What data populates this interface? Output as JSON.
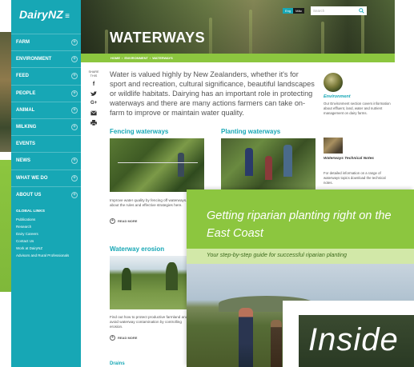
{
  "brand": {
    "logo": "DairyNZ"
  },
  "header": {
    "title": "WATERWAYS",
    "lang": [
      "Eng",
      "Māo"
    ],
    "search_placeholder": "Search"
  },
  "breadcrumb": [
    "HOME",
    "ENVIRONMENT",
    "WATERWAYS"
  ],
  "sidebar": {
    "items": [
      {
        "label": "FARM"
      },
      {
        "label": "ENVIRONMENT"
      },
      {
        "label": "FEED"
      },
      {
        "label": "PEOPLE"
      },
      {
        "label": "ANIMAL"
      },
      {
        "label": "MILKING"
      },
      {
        "label": "EVENTS"
      },
      {
        "label": "NEWS"
      },
      {
        "label": "WHAT WE DO"
      },
      {
        "label": "ABOUT US"
      }
    ],
    "global_heading": "GLOBAL LINKS",
    "global_links": [
      "Publications",
      "Research",
      "Dairy Careers",
      "Contact Us",
      "Work at DairyNZ",
      "Advisors and Rural Professionals"
    ]
  },
  "share": {
    "label_line1": "SHARE",
    "label_line2": "THIS"
  },
  "intro": "Water is valued highly by New Zealanders, whether it's for sport and recreation, cultural significance, beautiful landscapes or wildlife habitats. Dairying has an important role in protecting waterways and there are many actions farmers can take on-farm to improve or maintain water quality.",
  "cards": {
    "fencing": {
      "title": "Fencing waterways",
      "text": "Improve water quality by fencing off waterways. Find out about the rules and effective strategies here.",
      "read_more": "READ MORE"
    },
    "planting": {
      "title": "Planting waterways"
    },
    "erosion": {
      "title": "Waterway erosion",
      "text": "Find out how to protect productive farmland and avoid waterway contamination by controlling erosion.",
      "read_more": "READ MORE"
    },
    "drains": {
      "title": "Drains"
    }
  },
  "right": {
    "env_title": "Environment",
    "env_text": "Our Environment section covers information about effluent, land, water and nutrient management on dairy farms.",
    "wt_title": "Waterways Technical Notes",
    "wt_text": "For detailed information on a range of waterways topics download the technical notes."
  },
  "booklet": {
    "title": "Getting riparian planting right on the East Coast",
    "subtitle": "Your step-by-step guide for successful riparian planting",
    "inside": "Inside"
  },
  "colors": {
    "teal": "#17a7b5",
    "green": "#8cc63f"
  }
}
